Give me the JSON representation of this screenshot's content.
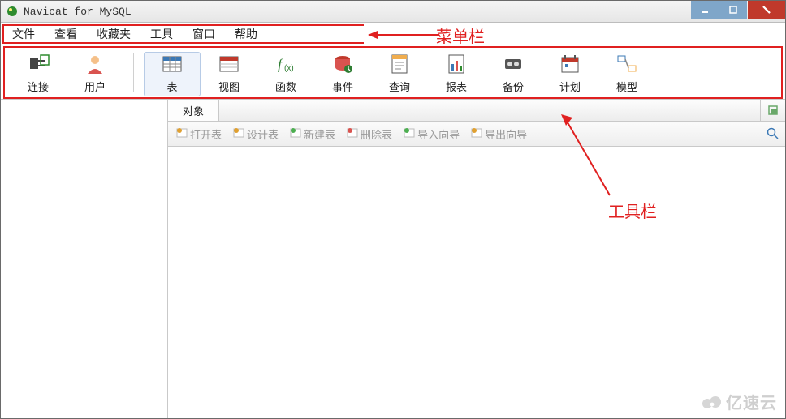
{
  "title": "Navicat for MySQL",
  "menu": {
    "items": [
      "文件",
      "查看",
      "收藏夹",
      "工具",
      "窗口",
      "帮助"
    ]
  },
  "toolbar": {
    "groups": [
      {
        "items": [
          {
            "id": "connect",
            "label": "连接",
            "icon": "plug-icon"
          },
          {
            "id": "user",
            "label": "用户",
            "icon": "user-icon"
          }
        ]
      },
      {
        "items": [
          {
            "id": "table",
            "label": "表",
            "icon": "table-icon",
            "selected": true
          },
          {
            "id": "view",
            "label": "视图",
            "icon": "view-icon"
          },
          {
            "id": "function",
            "label": "函数",
            "icon": "function-icon"
          },
          {
            "id": "event",
            "label": "事件",
            "icon": "event-icon"
          },
          {
            "id": "query",
            "label": "查询",
            "icon": "query-icon"
          },
          {
            "id": "report",
            "label": "报表",
            "icon": "report-icon"
          },
          {
            "id": "backup",
            "label": "备份",
            "icon": "backup-icon"
          },
          {
            "id": "schedule",
            "label": "计划",
            "icon": "schedule-icon"
          },
          {
            "id": "model",
            "label": "模型",
            "icon": "model-icon"
          }
        ]
      }
    ]
  },
  "object_tab": {
    "label": "对象"
  },
  "object_toolbar": {
    "items": [
      {
        "id": "open",
        "label": "打开表",
        "icon": "open-table-icon"
      },
      {
        "id": "design",
        "label": "设计表",
        "icon": "design-table-icon"
      },
      {
        "id": "new",
        "label": "新建表",
        "icon": "new-table-icon"
      },
      {
        "id": "delete",
        "label": "删除表",
        "icon": "delete-table-icon"
      },
      {
        "id": "import",
        "label": "导入向导",
        "icon": "import-icon"
      },
      {
        "id": "export",
        "label": "导出向导",
        "icon": "export-icon"
      }
    ]
  },
  "annotations": {
    "menu_label": "菜单栏",
    "tool_label": "工具栏"
  },
  "watermark": "亿速云"
}
